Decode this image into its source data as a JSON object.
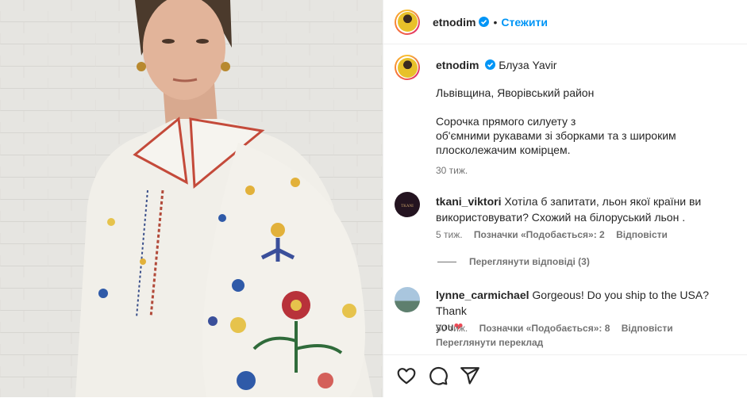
{
  "post": {
    "username": "etnodim",
    "follow_label": "Стежити",
    "dot": "•"
  },
  "caption": {
    "username": "etnodim",
    "title": "Блуза Yavir",
    "lines": [
      "Львівщина, Яворівський район",
      "Сорочка прямого силуету з",
      "об'ємними рукавами зі зборками та з широким",
      "плосколежачим комірцем."
    ],
    "time": "30 тиж."
  },
  "comments": [
    {
      "username": "tkani_viktori",
      "text_line1": "Хотіла б запитати, льон якої країни ви",
      "text_line2": "використовувати? Схожий на білоруський льон .",
      "time": "5 тиж.",
      "likes": "Позначки «Подобається»: 2",
      "reply": "Відповісти",
      "view_replies": "Переглянути відповіді (3)"
    },
    {
      "username": "lynne_carmichael",
      "text_line1": "Gorgeous! Do you ship to the USA? Thank",
      "text_line2": "you",
      "heart": "❤",
      "time": "30 тиж.",
      "likes": "Позначки «Подобається»: 8",
      "reply": "Відповісти",
      "translate": "Переглянути переклад"
    }
  ],
  "icons": [
    "heart-icon",
    "comment-icon",
    "share-icon",
    "verified-badge-icon"
  ],
  "colors": {
    "link": "#0095f6",
    "verified": "#0095f6",
    "heart": "#ed4956",
    "muted": "#737373"
  }
}
